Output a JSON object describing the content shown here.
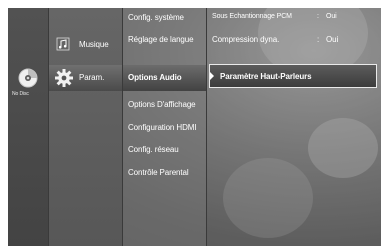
{
  "disc": {
    "label": "No Disc"
  },
  "main_menu": {
    "items": [
      {
        "label": "Musique",
        "icon": "music-note-icon"
      },
      {
        "label": "Param.",
        "icon": "gear-icon",
        "selected": true
      }
    ]
  },
  "sub_menu": {
    "items": [
      {
        "label": "Config. système"
      },
      {
        "label": "Réglage de langue"
      },
      {
        "label": "Options Audio",
        "selected": true
      },
      {
        "label": "Options D'affichage"
      },
      {
        "label": "Configuration HDMI"
      },
      {
        "label": "Config. réseau"
      },
      {
        "label": "Contrôle Parental"
      }
    ]
  },
  "detail": {
    "rows": [
      {
        "label": "Sous Echantionnage PCM",
        "sep": ":",
        "value": "Oui"
      },
      {
        "label": "Compression dyna.",
        "sep": ":",
        "value": "Oui"
      }
    ],
    "selected_label": "Paramètre Haut-Parleurs"
  },
  "colors": {
    "background": "#6e6e6e",
    "highlight_border": "#eaeaea",
    "text": "#ffffff"
  }
}
